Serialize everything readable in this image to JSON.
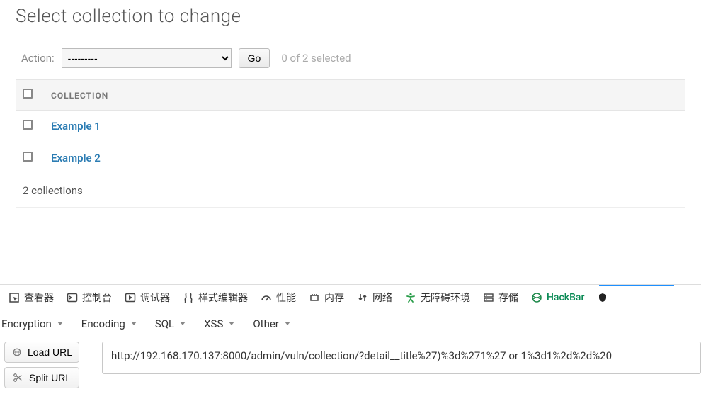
{
  "page": {
    "title": "Select collection to change"
  },
  "actions": {
    "label": "Action:",
    "selected_option": "---------",
    "go_label": "Go",
    "selected_count": "0 of 2 selected"
  },
  "table": {
    "column_header": "COLLECTION",
    "rows": [
      {
        "label": "Example 1"
      },
      {
        "label": "Example 2"
      }
    ],
    "footer": "2 collections"
  },
  "devtools": {
    "panels": [
      {
        "id": "inspector",
        "label": "查看器"
      },
      {
        "id": "console",
        "label": "控制台"
      },
      {
        "id": "debugger",
        "label": "调试器"
      },
      {
        "id": "styleeditor",
        "label": "样式编辑器"
      },
      {
        "id": "performance",
        "label": "性能"
      },
      {
        "id": "memory",
        "label": "内存"
      },
      {
        "id": "network",
        "label": "网络"
      },
      {
        "id": "accessibility",
        "label": "无障碍环境"
      },
      {
        "id": "storage",
        "label": "存储"
      },
      {
        "id": "hackbar",
        "label": "HackBar"
      }
    ],
    "toolbar": [
      {
        "id": "encryption",
        "label": "Encryption"
      },
      {
        "id": "encoding",
        "label": "Encoding"
      },
      {
        "id": "sql",
        "label": "SQL"
      },
      {
        "id": "xss",
        "label": "XSS"
      },
      {
        "id": "other",
        "label": "Other"
      }
    ],
    "side_buttons": {
      "load": "Load URL",
      "split": "Split URL"
    },
    "url_value": "http://192.168.170.137:8000/admin/vuln/collection/?detail__title%27)%3d%271%27 or 1%3d1%2d%2d%20"
  }
}
